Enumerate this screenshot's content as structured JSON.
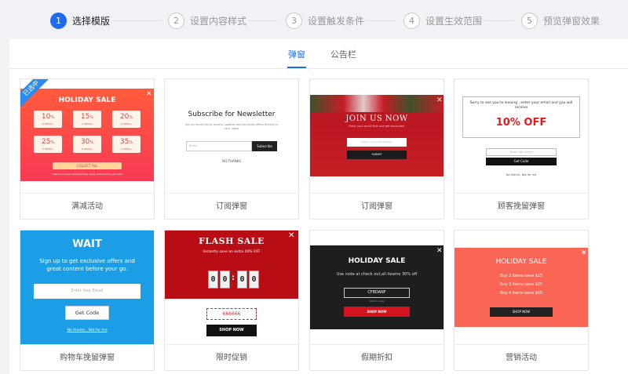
{
  "stepper": {
    "steps": [
      {
        "num": "1",
        "label": "选择模版"
      },
      {
        "num": "2",
        "label": "设置内容样式"
      },
      {
        "num": "3",
        "label": "设置触发条件"
      },
      {
        "num": "4",
        "label": "设置生效范围"
      },
      {
        "num": "5",
        "label": "预览弹窗效果"
      }
    ],
    "active_index": 0
  },
  "tabs": [
    {
      "label": "弹窗",
      "active": true
    },
    {
      "label": "公告栏",
      "active": false
    }
  ],
  "colors": {
    "primary": "#1f6cf2",
    "selected_ribbon": "#2a8cf0"
  },
  "templates": [
    {
      "label": "满减活动",
      "selected_badge": "已选中",
      "title": "HOLIDAY SALE",
      "coupons": [
        {
          "value": "10",
          "unit": "%",
          "note": "2 ITEMS+"
        },
        {
          "value": "15",
          "unit": "%",
          "note": "3 ITEMS+"
        },
        {
          "value": "20",
          "unit": "%",
          "note": "4 ITEMS+"
        },
        {
          "value": "25",
          "unit": "%",
          "note": "5 ITEMS+"
        },
        {
          "value": "30",
          "unit": "%",
          "note": "6 ITEMS+"
        },
        {
          "value": "35",
          "unit": "%",
          "note": "7 ITEMS+"
        }
      ],
      "button": "COLLECT ALL",
      "footnote": "*Discount would automatically apply when placing an order"
    },
    {
      "label": "订阅弹窗",
      "title": "Subscribe for Newsletter",
      "subtitle": "Join our email list to receive updates and exclusive offers directly in your inbox",
      "input_placeholder": "Email",
      "button": "Subscribe",
      "dismiss": "NO,THANKS"
    },
    {
      "label": "订阅弹窗",
      "title": "JOIN US NOW",
      "subtitle": "Enter your email first and get discounts!",
      "input_placeholder": "Enter your email address",
      "button": "SUBMIT"
    },
    {
      "label": "顾客挽留弹窗",
      "message": "Sorry to see you're leaving , enter your email and you will receive",
      "offer": "10% OFF",
      "input_placeholder": "Email Your Email",
      "button": "Get Code",
      "dismiss": "No thanks, Not for me"
    },
    {
      "label": "购物车挽留弹窗",
      "title": "WAIT",
      "subtitle": "Sign up to get exclusive offers and great content before your go.",
      "input_placeholder": "Enter Your Email",
      "button": "Get Code",
      "dismiss": "No thanks , Not for me"
    },
    {
      "label": "限时促销",
      "title": "FLASH SALE",
      "subtitle": "Instantly save an extra 10% OFF",
      "digits": [
        "0",
        "0",
        "0",
        "0"
      ],
      "code": "666666",
      "button": "SHOP NOW"
    },
    {
      "label": "假期折扣",
      "title": "HOLIDAY SALE",
      "subtitle": "Use code at check out,all iteams 30% off",
      "code": "CF8DANF",
      "copy_hint": "Click to copy",
      "button": "SHOP NOW"
    },
    {
      "label": "营销活动",
      "title": "HOLIDAY SALE",
      "lines": [
        "Buy 2 items save $15",
        "Buy 3 items save $25",
        "Buy 4 items save $60"
      ],
      "button": "SHOP NOW"
    }
  ]
}
